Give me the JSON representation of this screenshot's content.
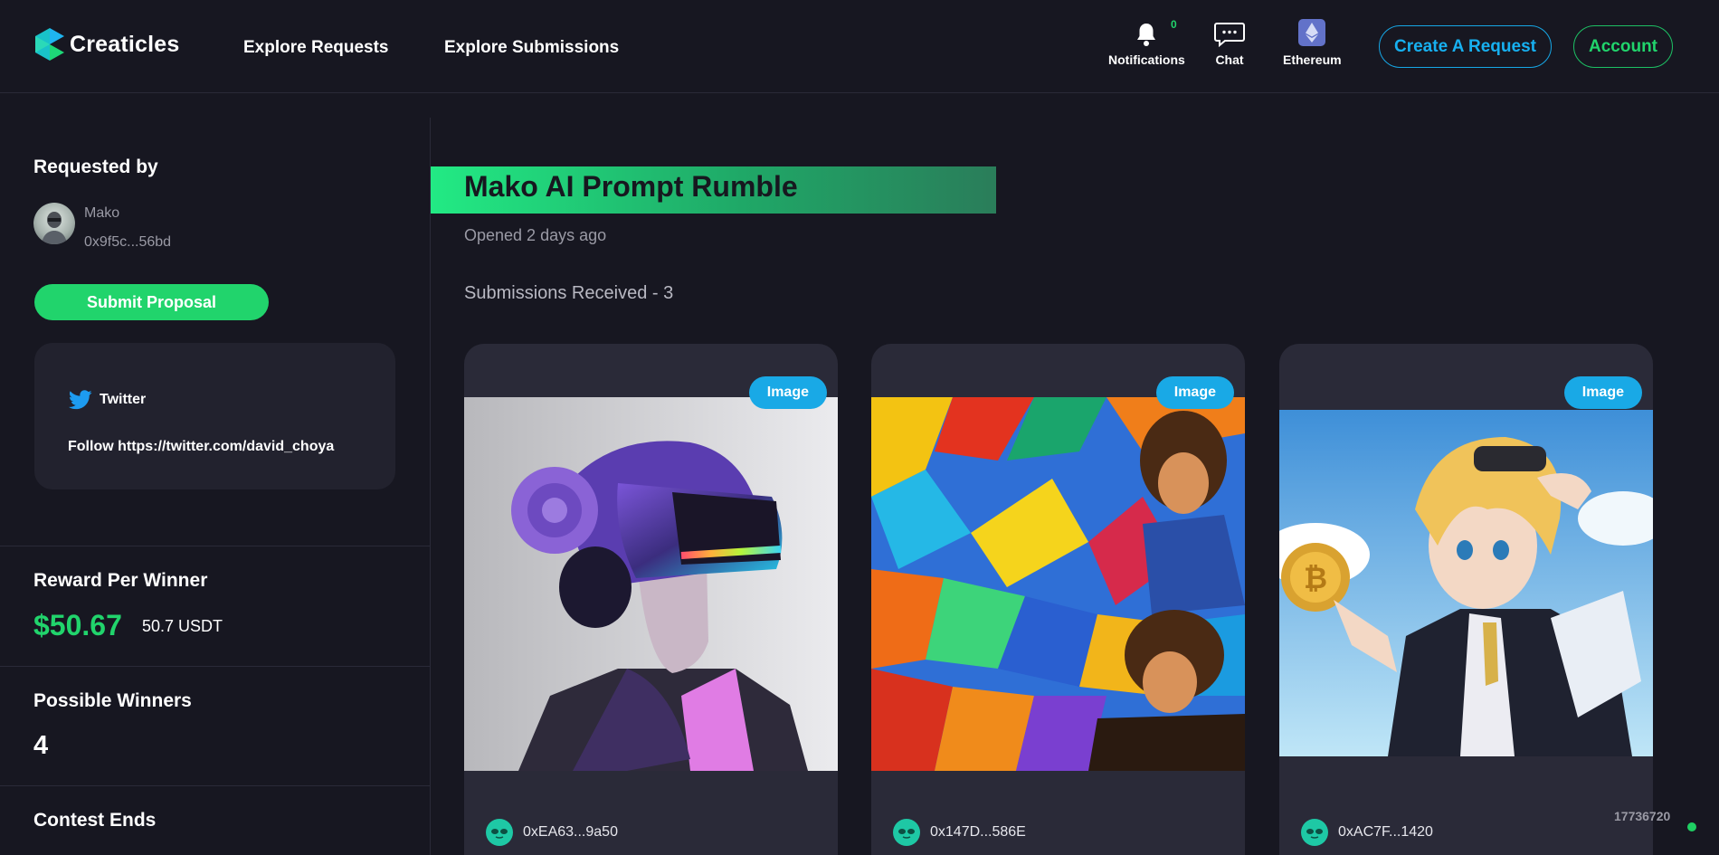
{
  "header": {
    "logo_text": "Creaticles",
    "nav": [
      "Explore Requests",
      "Explore Submissions"
    ],
    "notifications": {
      "label": "Notifications",
      "count": "0"
    },
    "chat": {
      "label": "Chat"
    },
    "network": {
      "label": "Ethereum"
    },
    "create_request": "Create A Request",
    "account": "Account"
  },
  "sidebar": {
    "requested_by_title": "Requested by",
    "requester_name": "Mako",
    "requester_address": "0x9f5c...56bd",
    "submit_button": "Submit Proposal",
    "twitter": {
      "label": "Twitter",
      "text": "Follow https://twitter.com/david_choya"
    },
    "reward": {
      "title": "Reward Per Winner",
      "usd": "$50.67",
      "token": "50.7 USDT"
    },
    "winners": {
      "title": "Possible Winners",
      "value": "4"
    },
    "contest_ends_title": "Contest Ends"
  },
  "main": {
    "title": "Mako AI Prompt Rumble",
    "opened": "Opened 2 days ago",
    "submissions_received": "Submissions Received - 3",
    "cards": [
      {
        "type": "Image",
        "address": "0xEA63...9a50"
      },
      {
        "type": "Image",
        "address": "0x147D...586E"
      },
      {
        "type": "Image",
        "address": "0xAC7F...1420"
      }
    ]
  },
  "footer": {
    "block_number": "17736720"
  },
  "colors": {
    "background": "#171721",
    "green": "#21d46c",
    "blue": "#17b0f0",
    "card": "#2a2a38"
  }
}
